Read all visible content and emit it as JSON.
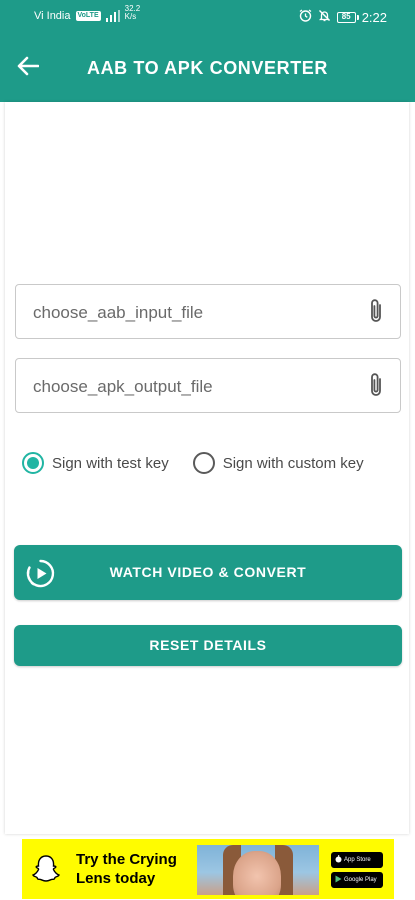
{
  "status_bar": {
    "carrier": "Vi India",
    "volte": "VoLTE",
    "net_speed_value": "32.2",
    "net_speed_unit": "K/s",
    "battery": "85",
    "time": "2:22"
  },
  "toolbar": {
    "title": "AAB TO APK CONVERTER"
  },
  "form": {
    "input_file_placeholder": "choose_aab_input_file",
    "output_file_placeholder": "choose_apk_output_file",
    "sign_options": [
      {
        "label": "Sign with test key",
        "selected": true
      },
      {
        "label": "Sign with custom key",
        "selected": false
      }
    ]
  },
  "buttons": {
    "convert_label": "WATCH VIDEO & CONVERT",
    "reset_label": "RESET DETAILS"
  },
  "ad": {
    "headline": "Try the Crying Lens today",
    "app_store": "App Store",
    "google_play": "Google Play"
  },
  "colors": {
    "primary": "#1e9b89",
    "radio_accent": "#21b5a3",
    "ad_background": "#fffc00"
  }
}
